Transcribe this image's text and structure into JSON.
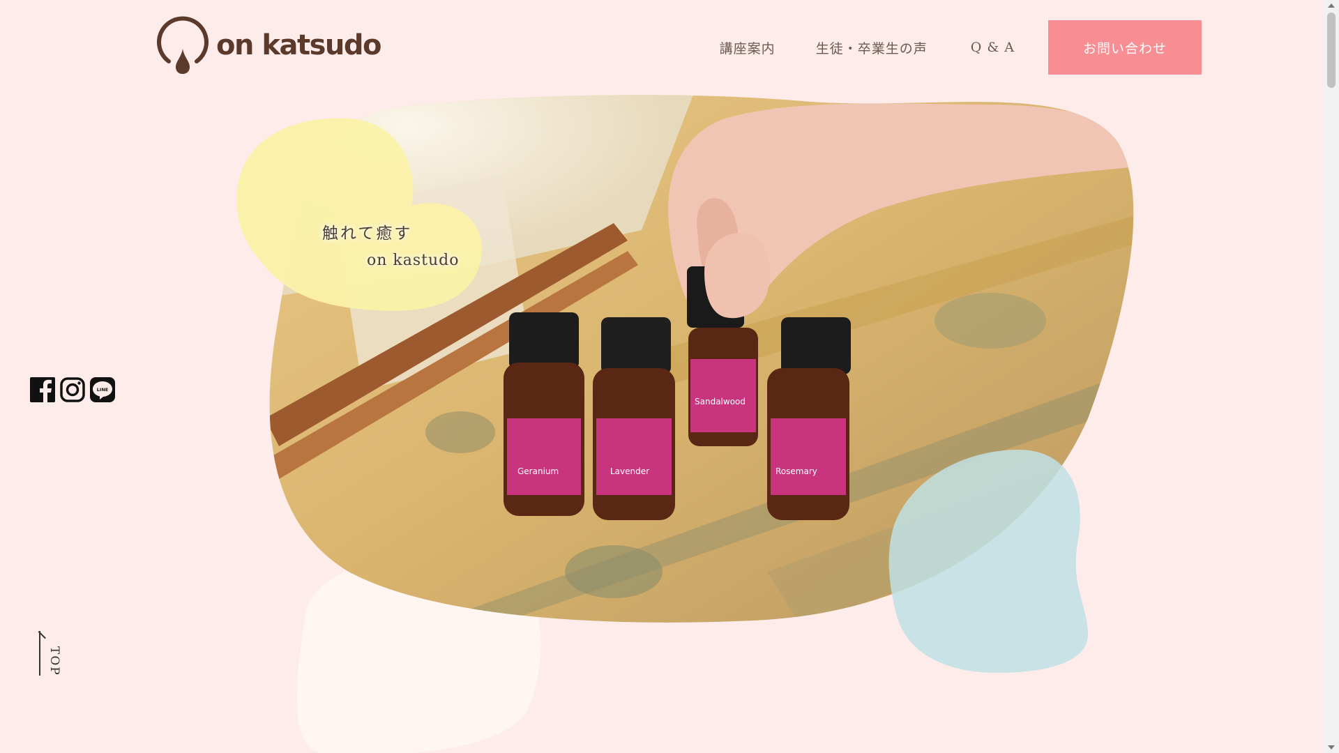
{
  "logo": {
    "text": "on katsudo",
    "mark_color": "#5b3a2c"
  },
  "nav": {
    "items": [
      "講座案内",
      "生徒・卒業生の声",
      "Q & A"
    ],
    "contact_label": "お問い合わせ",
    "contact_color": "#f88d93"
  },
  "hero": {
    "catch_line1": "触れて癒す",
    "catch_line2": "on kastudo",
    "photo_labels": [
      "Geranium",
      "Lavender",
      "Sandalwood",
      "Rosemary"
    ]
  },
  "social": {
    "icons": [
      "facebook-icon",
      "instagram-icon",
      "line-icon"
    ],
    "line_label": "LINE"
  },
  "top_link": {
    "label": "TOP"
  },
  "colors": {
    "background": "#fdecea",
    "yellow_blob": "#fbf1a8",
    "blue_blob": "#c5e4e5",
    "cream_blob": "#fff6f2"
  }
}
